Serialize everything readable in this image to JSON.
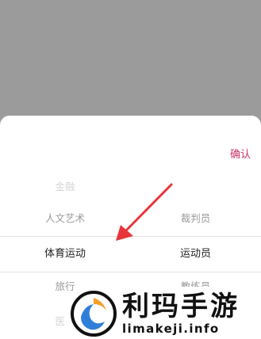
{
  "picker": {
    "confirm_label": "确认",
    "left_column": {
      "options": [
        "金融",
        "人文艺术",
        "体育运动",
        "旅行",
        "医疗"
      ],
      "selected": "体育运动"
    },
    "right_column": {
      "options": [
        "裁判员",
        "运动员",
        "教练员"
      ],
      "selected": "运动员"
    }
  },
  "colors": {
    "overlay": "#9b9b9b",
    "confirm_accent": "#c8336b",
    "arrow": "#e8353a"
  },
  "watermark": {
    "title": "利玛手游",
    "url": "limakeji.info"
  }
}
